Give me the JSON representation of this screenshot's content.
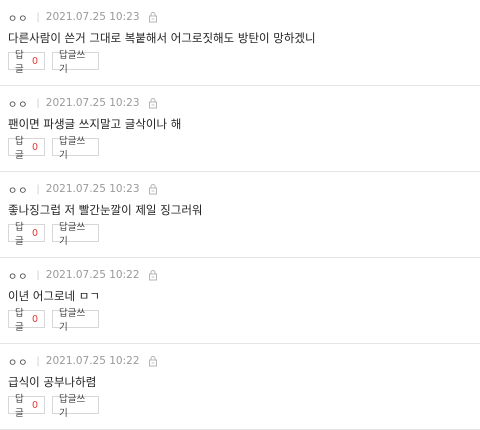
{
  "comments": [
    {
      "author": "ㅇㅇ",
      "date": "2021.07.25 10:23",
      "body": "다른사람이 쓴거 그대로 복붙해서 어그로짓해도 방탄이 망하겠니",
      "reply_label": "답글",
      "reply_count": "0",
      "write_reply_label": "답글쓰기"
    },
    {
      "author": "ㅇㅇ",
      "date": "2021.07.25 10:23",
      "body": "팬이면 파생글 쓰지말고 글삭이나 해",
      "reply_label": "답글",
      "reply_count": "0",
      "write_reply_label": "답글쓰기"
    },
    {
      "author": "ㅇㅇ",
      "date": "2021.07.25 10:23",
      "body": "좋나징그럽 저 빨간눈깔이 제일 징그러워",
      "reply_label": "답글",
      "reply_count": "0",
      "write_reply_label": "답글쓰기"
    },
    {
      "author": "ㅇㅇ",
      "date": "2021.07.25 10:22",
      "body": "이년 어그로네 ㅁㄱ",
      "reply_label": "답글",
      "reply_count": "0",
      "write_reply_label": "답글쓰기"
    },
    {
      "author": "ㅇㅇ",
      "date": "2021.07.25 10:22",
      "body": "급식이 공부나하렴",
      "reply_label": "답글",
      "reply_count": "0",
      "write_reply_label": "답글쓰기"
    }
  ],
  "icons": {
    "anonymous": "lock-icon"
  },
  "colors": {
    "reply_count": "#e53935",
    "meta_text": "#999999",
    "border": "#d7d7d7"
  }
}
